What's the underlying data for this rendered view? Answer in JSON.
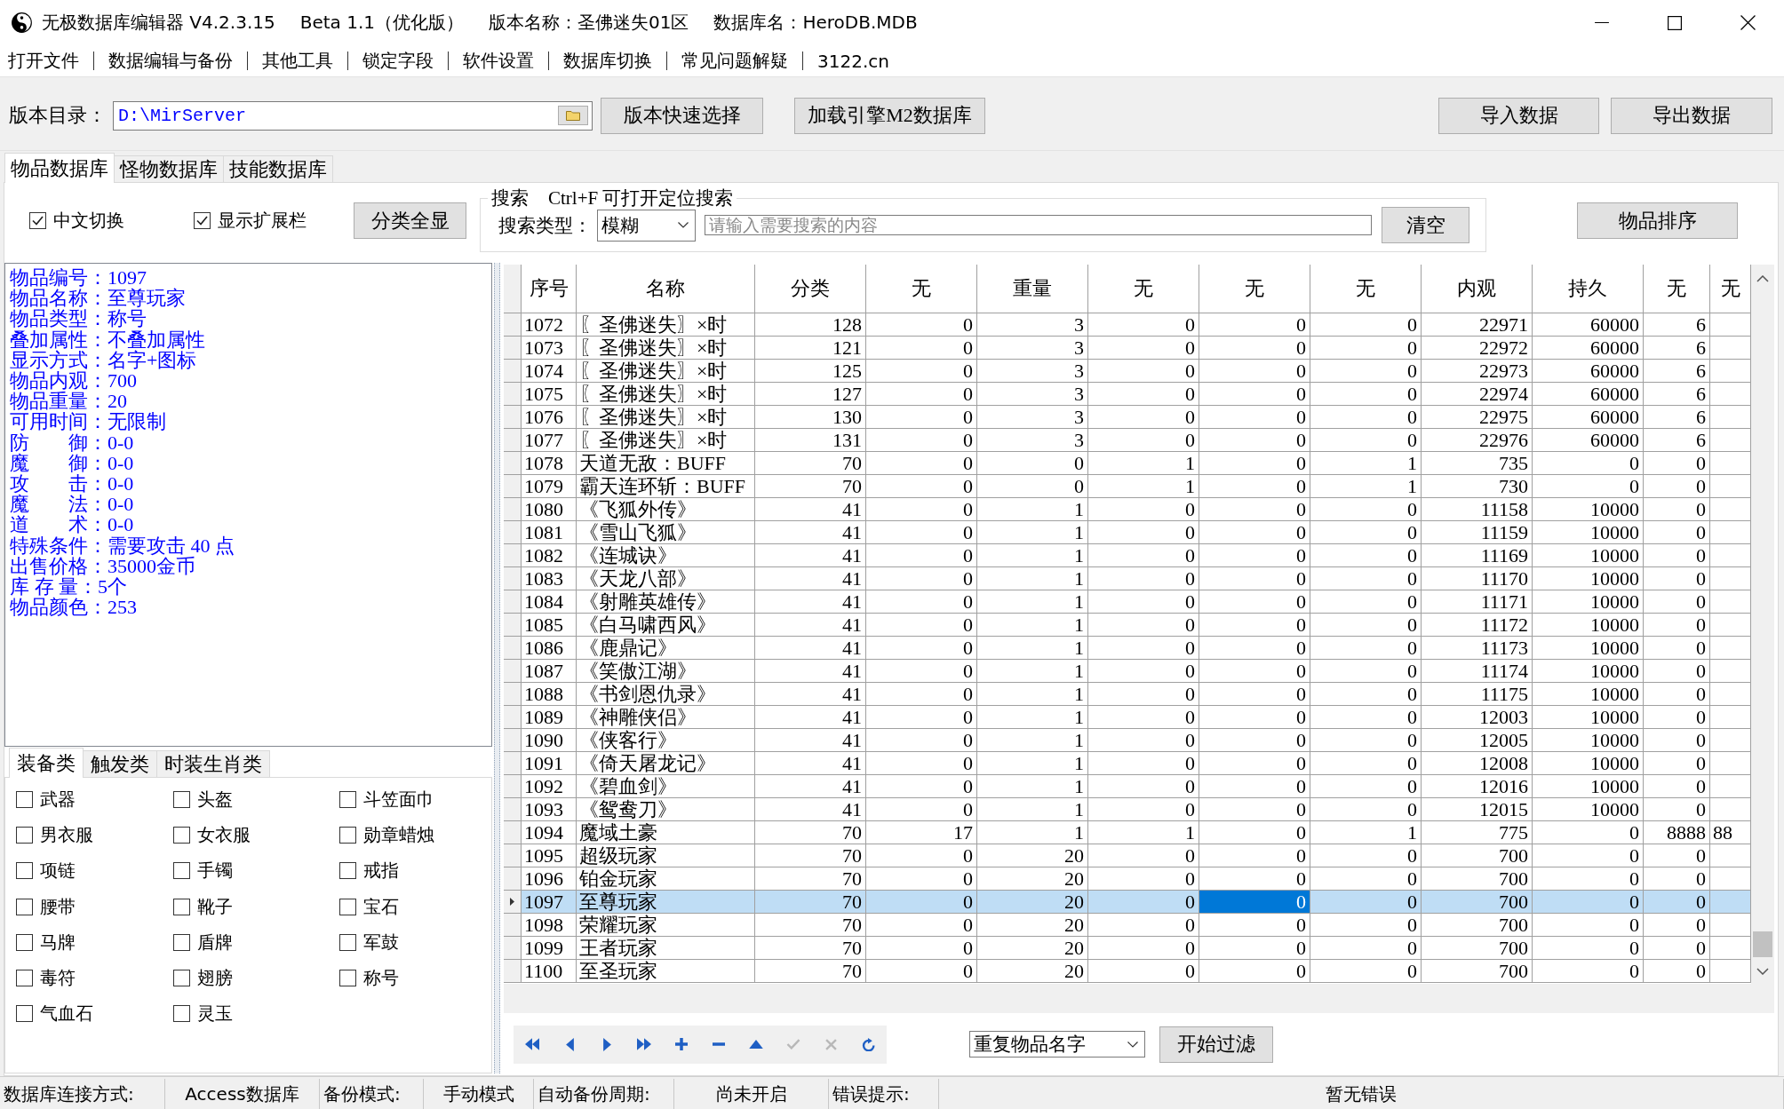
{
  "window": {
    "title": [
      "无极数据库编辑器 V4.2.3.15",
      "Beta 1.1（优化版）",
      "版本名称：圣佛迷失01区",
      "数据库名：HeroDB.MDB"
    ]
  },
  "menu": [
    "打开文件",
    "数据编辑与备份",
    "其他工具",
    "锁定字段",
    "软件设置",
    "数据库切换",
    "常见问题解疑",
    "3122.cn"
  ],
  "toolbar": {
    "directory": {
      "label": "版本目录：",
      "value": "D:\\MirServer"
    },
    "buttons": [
      "版本快速选择",
      "加载引擎M2数据库"
    ],
    "data_buttons": [
      "导入数据",
      "导出数据"
    ]
  },
  "tabs": [
    {
      "label": "物品数据库",
      "selected": true
    },
    {
      "label": "怪物数据库",
      "selected": false
    },
    {
      "label": "技能数据库",
      "selected": false
    }
  ],
  "options": [
    {
      "label": "中文切换",
      "checked": true
    },
    {
      "label": "显示扩展栏",
      "checked": true
    }
  ],
  "show_all_button": "分类全显",
  "search": {
    "title": "搜索",
    "hint": "Ctrl+F 可打开定位搜索",
    "type_label": "搜索类型：",
    "type_value": "模糊",
    "placeholder": "请输入需要搜索的内容",
    "clear_button": "清空"
  },
  "sort_button": "物品排序",
  "details": [
    {
      "label": "物品编号：",
      "value": "1097"
    },
    {
      "label": "物品名称：",
      "value": "至尊玩家"
    },
    {
      "label": "物品类型：",
      "value": "称号"
    },
    {
      "label": "叠加属性：",
      "value": "不叠加属性"
    },
    {
      "label": "显示方式：",
      "value": "名字+图标"
    },
    {
      "label": "物品内观：",
      "value": "700"
    },
    {
      "label": "物品重量：",
      "value": "20"
    },
    {
      "label": "可用时间：",
      "value": "无限制"
    },
    {
      "label": "防　　御：",
      "value": "0-0"
    },
    {
      "label": "魔　　御：",
      "value": "0-0"
    },
    {
      "label": "攻　　击：",
      "value": "0-0"
    },
    {
      "label": "魔　　法：",
      "value": "0-0"
    },
    {
      "label": "道　　术：",
      "value": "0-0"
    },
    {
      "label": "特殊条件：",
      "value": "需要攻击 40 点"
    },
    {
      "label": "出售价格：",
      "value": "35000金币"
    },
    {
      "label": "库 存 量：",
      "value": "5个"
    },
    {
      "label": "物品颜色：",
      "value": "253"
    }
  ],
  "category_tabs": [
    {
      "label": "装备类",
      "selected": true
    },
    {
      "label": "触发类",
      "selected": false
    },
    {
      "label": "时装生肖类",
      "selected": false
    }
  ],
  "categories": [
    {
      "label": "武器",
      "checked": false
    },
    {
      "label": "头盔",
      "checked": false
    },
    {
      "label": "斗笠面巾",
      "checked": false
    },
    {
      "label": "男衣服",
      "checked": false
    },
    {
      "label": "女衣服",
      "checked": false
    },
    {
      "label": "勋章蜡烛",
      "checked": false
    },
    {
      "label": "项链",
      "checked": false
    },
    {
      "label": "手镯",
      "checked": false
    },
    {
      "label": "戒指",
      "checked": false
    },
    {
      "label": "腰带",
      "checked": false
    },
    {
      "label": "靴子",
      "checked": false
    },
    {
      "label": "宝石",
      "checked": false
    },
    {
      "label": "马牌",
      "checked": false
    },
    {
      "label": "盾牌",
      "checked": false
    },
    {
      "label": "军鼓",
      "checked": false
    },
    {
      "label": "毒符",
      "checked": false
    },
    {
      "label": "翅膀",
      "checked": false
    },
    {
      "label": "称号",
      "checked": false
    },
    {
      "label": "气血石",
      "checked": false
    },
    {
      "label": "灵玉",
      "checked": false
    }
  ],
  "table": {
    "columns": [
      {
        "label": "序号",
        "focused": false
      },
      {
        "label": "名称",
        "focused": false
      },
      {
        "label": "分类",
        "focused": false
      },
      {
        "label": "无",
        "focused": false
      },
      {
        "label": "重量",
        "focused": false
      },
      {
        "label": "无",
        "focused": false
      },
      {
        "label": "无",
        "focused": true
      },
      {
        "label": "无",
        "focused": false
      },
      {
        "label": "内观",
        "focused": false
      },
      {
        "label": "持久",
        "focused": false
      },
      {
        "label": "无",
        "focused": false
      },
      {
        "label": "无",
        "focused": false
      }
    ],
    "rows": [
      {
        "selected": false,
        "cells": [
          "1072",
          "〖圣佛迷失〗×时",
          "128",
          "0",
          "3",
          "0",
          "0",
          "0",
          "22971",
          "60000",
          "6"
        ]
      },
      {
        "selected": false,
        "cells": [
          "1073",
          "〖圣佛迷失〗×时",
          "121",
          "0",
          "3",
          "0",
          "0",
          "0",
          "22972",
          "60000",
          "6"
        ]
      },
      {
        "selected": false,
        "cells": [
          "1074",
          "〖圣佛迷失〗×时",
          "125",
          "0",
          "3",
          "0",
          "0",
          "0",
          "22973",
          "60000",
          "6"
        ]
      },
      {
        "selected": false,
        "cells": [
          "1075",
          "〖圣佛迷失〗×时",
          "127",
          "0",
          "3",
          "0",
          "0",
          "0",
          "22974",
          "60000",
          "6"
        ]
      },
      {
        "selected": false,
        "cells": [
          "1076",
          "〖圣佛迷失〗×时",
          "130",
          "0",
          "3",
          "0",
          "0",
          "0",
          "22975",
          "60000",
          "6"
        ]
      },
      {
        "selected": false,
        "cells": [
          "1077",
          "〖圣佛迷失〗×时",
          "131",
          "0",
          "3",
          "0",
          "0",
          "0",
          "22976",
          "60000",
          "6"
        ]
      },
      {
        "selected": false,
        "cells": [
          "1078",
          "天道无敌：BUFF",
          "70",
          "0",
          "0",
          "1",
          "0",
          "1",
          "735",
          "0",
          "0"
        ]
      },
      {
        "selected": false,
        "cells": [
          "1079",
          "霸天连环斩：BUFF",
          "70",
          "0",
          "0",
          "1",
          "0",
          "1",
          "730",
          "0",
          "0"
        ]
      },
      {
        "selected": false,
        "cells": [
          "1080",
          "《飞狐外传》",
          "41",
          "0",
          "1",
          "0",
          "0",
          "0",
          "11158",
          "10000",
          "0"
        ]
      },
      {
        "selected": false,
        "cells": [
          "1081",
          "《雪山飞狐》",
          "41",
          "0",
          "1",
          "0",
          "0",
          "0",
          "11159",
          "10000",
          "0"
        ]
      },
      {
        "selected": false,
        "cells": [
          "1082",
          "《连城诀》",
          "41",
          "0",
          "1",
          "0",
          "0",
          "0",
          "11169",
          "10000",
          "0"
        ]
      },
      {
        "selected": false,
        "cells": [
          "1083",
          "《天龙八部》",
          "41",
          "0",
          "1",
          "0",
          "0",
          "0",
          "11170",
          "10000",
          "0"
        ]
      },
      {
        "selected": false,
        "cells": [
          "1084",
          "《射雕英雄传》",
          "41",
          "0",
          "1",
          "0",
          "0",
          "0",
          "11171",
          "10000",
          "0"
        ]
      },
      {
        "selected": false,
        "cells": [
          "1085",
          "《白马啸西风》",
          "41",
          "0",
          "1",
          "0",
          "0",
          "0",
          "11172",
          "10000",
          "0"
        ]
      },
      {
        "selected": false,
        "cells": [
          "1086",
          "《鹿鼎记》",
          "41",
          "0",
          "1",
          "0",
          "0",
          "0",
          "11173",
          "10000",
          "0"
        ]
      },
      {
        "selected": false,
        "cells": [
          "1087",
          "《笑傲江湖》",
          "41",
          "0",
          "1",
          "0",
          "0",
          "0",
          "11174",
          "10000",
          "0"
        ]
      },
      {
        "selected": false,
        "cells": [
          "1088",
          "《书剑恩仇录》",
          "41",
          "0",
          "1",
          "0",
          "0",
          "0",
          "11175",
          "10000",
          "0"
        ]
      },
      {
        "selected": false,
        "cells": [
          "1089",
          "《神雕侠侣》",
          "41",
          "0",
          "1",
          "0",
          "0",
          "0",
          "12003",
          "10000",
          "0"
        ]
      },
      {
        "selected": false,
        "cells": [
          "1090",
          "《侠客行》",
          "41",
          "0",
          "1",
          "0",
          "0",
          "0",
          "12005",
          "10000",
          "0"
        ]
      },
      {
        "selected": false,
        "cells": [
          "1091",
          "《倚天屠龙记》",
          "41",
          "0",
          "1",
          "0",
          "0",
          "0",
          "12008",
          "10000",
          "0"
        ]
      },
      {
        "selected": false,
        "cells": [
          "1092",
          "《碧血剑》",
          "41",
          "0",
          "1",
          "0",
          "0",
          "0",
          "12016",
          "10000",
          "0"
        ]
      },
      {
        "selected": false,
        "cells": [
          "1093",
          "《鸳鸯刀》",
          "41",
          "0",
          "1",
          "0",
          "0",
          "0",
          "12015",
          "10000",
          "0"
        ]
      },
      {
        "selected": false,
        "cells": [
          "1094",
          "魔域土豪",
          "70",
          "17",
          "1",
          "1",
          "0",
          "1",
          "775",
          "0",
          "8888",
          "88"
        ]
      },
      {
        "selected": false,
        "cells": [
          "1095",
          "超级玩家",
          "70",
          "0",
          "20",
          "0",
          "0",
          "0",
          "700",
          "0",
          "0"
        ]
      },
      {
        "selected": false,
        "cells": [
          "1096",
          "铂金玩家",
          "70",
          "0",
          "20",
          "0",
          "0",
          "0",
          "700",
          "0",
          "0"
        ]
      },
      {
        "selected": true,
        "cells": [
          "1097",
          "至尊玩家",
          "70",
          "0",
          "20",
          "0",
          "0",
          "0",
          "700",
          "0",
          "0"
        ]
      },
      {
        "selected": false,
        "cells": [
          "1098",
          "荣耀玩家",
          "70",
          "0",
          "20",
          "0",
          "0",
          "0",
          "700",
          "0",
          "0"
        ]
      },
      {
        "selected": false,
        "cells": [
          "1099",
          "王者玩家",
          "70",
          "0",
          "20",
          "0",
          "0",
          "0",
          "700",
          "0",
          "0"
        ]
      },
      {
        "selected": false,
        "cells": [
          "1100",
          "至圣玩家",
          "70",
          "0",
          "20",
          "0",
          "0",
          "0",
          "700",
          "0",
          "0"
        ]
      }
    ]
  },
  "navigator": {
    "buttons": [
      {
        "kind": "first",
        "disabled": false
      },
      {
        "kind": "prior",
        "disabled": false
      },
      {
        "kind": "next",
        "disabled": false
      },
      {
        "kind": "last",
        "disabled": false
      },
      {
        "kind": "insert",
        "disabled": false
      },
      {
        "kind": "delete",
        "disabled": false
      },
      {
        "kind": "edit",
        "disabled": false
      },
      {
        "kind": "post",
        "disabled": true
      },
      {
        "kind": "cancel",
        "disabled": true
      },
      {
        "kind": "refresh",
        "disabled": false
      }
    ],
    "filter_select": "重复物品名字",
    "filter_button": "开始过滤"
  },
  "status_bar": [
    {
      "label": "数据库连接方式:",
      "value": "Access数据库"
    },
    {
      "label": "备份模式:",
      "value": "手动模式"
    },
    {
      "label": "自动备份周期:",
      "value": "尚未开启"
    },
    {
      "label": "错误提示:",
      "value": "暂无错误"
    }
  ]
}
